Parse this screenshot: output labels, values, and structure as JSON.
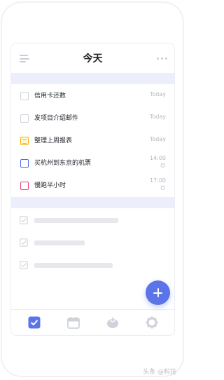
{
  "header": {
    "title": "今天",
    "menu_icon": "menu-icon",
    "more_icon": "more-icon"
  },
  "tasks": [
    {
      "label": "信用卡还数",
      "meta": "Today",
      "checkbox": "plain"
    },
    {
      "label": "发项目介绍邮件",
      "meta": "Today",
      "checkbox": "plain"
    },
    {
      "label": "整理上周报表",
      "meta": "Today",
      "checkbox": "yellow-note"
    },
    {
      "label": "买杭州到东京的机票",
      "time": "14:00",
      "icon": "alarm-icon",
      "checkbox": "blue"
    },
    {
      "label": "慢跑半小时",
      "time": "17:00",
      "icon": "alarm-icon",
      "checkbox": "red"
    }
  ],
  "completed_placeholders": 3,
  "fab": {
    "icon": "plus-icon"
  },
  "tabbar": {
    "items": [
      {
        "name": "tab-tasks",
        "icon": "checkbox-icon",
        "active": true
      },
      {
        "name": "tab-calendar",
        "icon": "calendar-icon",
        "active": false
      },
      {
        "name": "tab-pomodoro",
        "icon": "tomato-icon",
        "active": false
      },
      {
        "name": "tab-settings",
        "icon": "gear-icon",
        "active": false
      }
    ]
  },
  "colors": {
    "accent": "#5b74e8",
    "section_band": "#eceefb",
    "yellow": "#f5b400",
    "blue": "#4a6cf7",
    "red": "#ea3f79"
  },
  "watermark": "头条 @科技"
}
